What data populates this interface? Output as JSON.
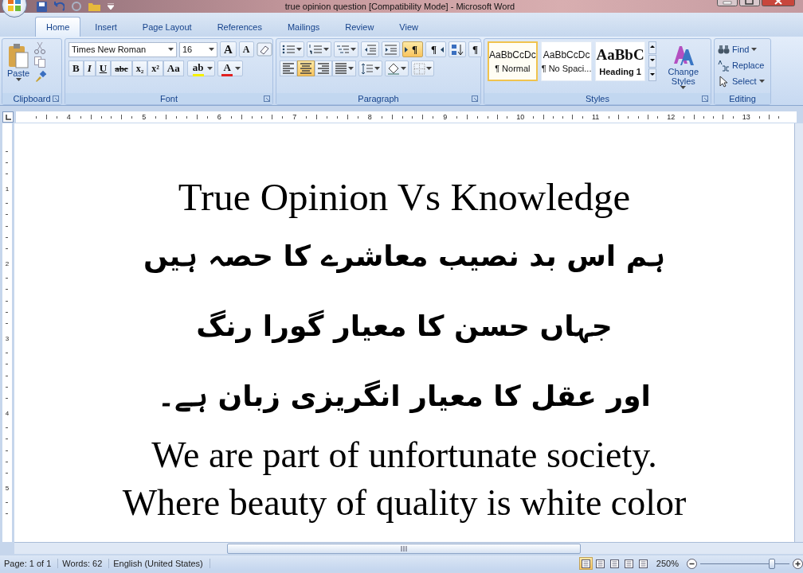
{
  "window": {
    "title": "true opinion question [Compatibility Mode] - Microsoft Word"
  },
  "tabs": [
    {
      "label": "Home",
      "selected": true
    },
    {
      "label": "Insert",
      "selected": false
    },
    {
      "label": "Page Layout",
      "selected": false
    },
    {
      "label": "References",
      "selected": false
    },
    {
      "label": "Mailings",
      "selected": false
    },
    {
      "label": "Review",
      "selected": false
    },
    {
      "label": "View",
      "selected": false
    }
  ],
  "clipboard": {
    "paste": "Paste",
    "label": "Clipboard"
  },
  "font": {
    "name": "Times New Roman",
    "size": "16",
    "label": "Font",
    "grow": [
      {
        "label": "A",
        "kind": "grow"
      },
      {
        "label": "A",
        "kind": "shrink"
      }
    ],
    "tools": [
      {
        "label": "B",
        "kind": "bold"
      },
      {
        "label": "I",
        "kind": "italic"
      },
      {
        "label": "U",
        "kind": "underline"
      },
      {
        "label": "abc",
        "kind": "strike"
      },
      {
        "label": "x₂",
        "kind": "sub"
      },
      {
        "label": "x²",
        "kind": "sup"
      },
      {
        "label": "Aa",
        "kind": "case"
      }
    ],
    "colors": [
      {
        "label": "ab",
        "color": "#f5f000"
      },
      {
        "label": "A",
        "color": "#e02020"
      }
    ]
  },
  "paragraph": {
    "label": "Paragraph",
    "show_marks": "¶",
    "direction": [
      {
        "label": "¶",
        "selected": true
      },
      {
        "label": "¶",
        "selected": false
      }
    ],
    "alignments": [
      {
        "selected": false
      },
      {
        "selected": true
      },
      {
        "selected": false
      },
      {
        "selected": false
      }
    ]
  },
  "styles": {
    "label": "Styles",
    "change": "Change Styles",
    "items": [
      {
        "preview": "AaBbCcDc",
        "name": "¶ Normal",
        "kind": "body",
        "selected": true
      },
      {
        "preview": "AaBbCcDc",
        "name": "¶ No Spaci...",
        "kind": "body",
        "selected": false
      },
      {
        "preview": "AaBbC",
        "name": "Heading 1",
        "kind": "heading",
        "selected": false
      }
    ]
  },
  "editing": {
    "label": "Editing",
    "items": [
      "Find",
      "Replace",
      "Select"
    ]
  },
  "ruler": {
    "h_marks": [
      "4",
      "5",
      "6",
      "7",
      "8",
      "9",
      "10",
      "11",
      "12",
      "13"
    ],
    "v_marks": [
      "1",
      "2",
      "3",
      "4",
      "5"
    ]
  },
  "document": {
    "paragraphs": [
      {
        "text": "True Opinion Vs Knowledge",
        "kind": "latin"
      },
      {
        "text": "ہم اس بد نصیب معاشرے کا حصہ ہیں",
        "kind": "urdu"
      },
      {
        "text": "جہاں حسن کا معیار گورا رنگ",
        "kind": "urdu"
      },
      {
        "text": "اور عقل کا معیار انگریزی زبان ہے۔",
        "kind": "urdu"
      },
      {
        "text": "We are part of unfortunate society.",
        "kind": "latin"
      },
      {
        "text": "Where beauty of quality is white color",
        "kind": "latin"
      }
    ]
  },
  "status_bar": {
    "page": "Page: 1 of 1",
    "words": "Words: 62",
    "language": "English (United States)",
    "zoom": "250%",
    "level": 0.8,
    "views": [
      {
        "selected": true
      },
      {
        "selected": false
      },
      {
        "selected": false
      },
      {
        "selected": false
      },
      {
        "selected": false
      }
    ]
  }
}
